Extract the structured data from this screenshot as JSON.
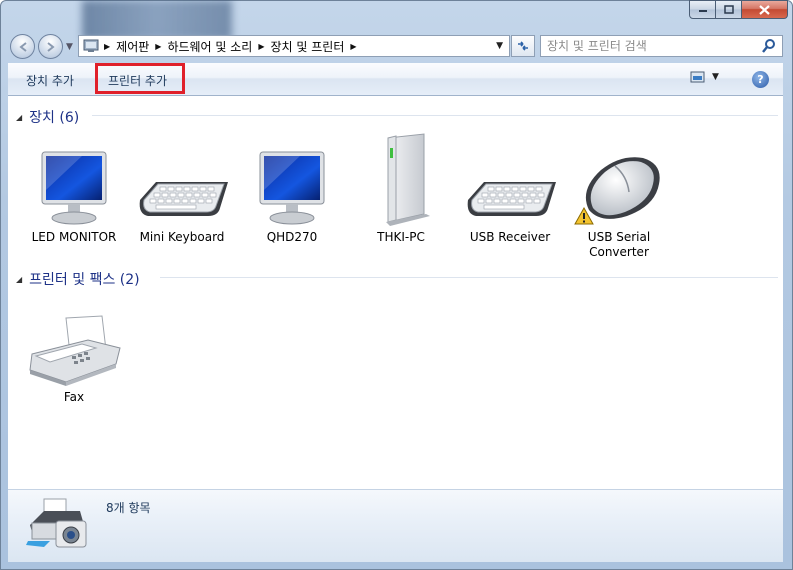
{
  "window": {
    "controls": {
      "minimize_icon": "minimize-icon",
      "maximize_icon": "maximize-icon",
      "close_icon": "close-icon"
    }
  },
  "address_bar": {
    "breadcrumbs": [
      "제어판",
      "하드웨어 및 소리",
      "장치 및 프린터"
    ]
  },
  "search": {
    "placeholder": "장치 및 프린터 검색"
  },
  "toolbar": {
    "add_device_label": "장치 추가",
    "add_printer_label": "프린터 추가",
    "highlight_color": "#e0202a"
  },
  "groups": {
    "devices": {
      "title": "장치 (6)",
      "items": [
        {
          "name": "LED MONITOR",
          "icon": "monitor-icon"
        },
        {
          "name": "Mini Keyboard",
          "icon": "keyboard-icon"
        },
        {
          "name": "QHD270",
          "icon": "monitor-icon"
        },
        {
          "name": "THKI-PC",
          "icon": "computer-tower-icon"
        },
        {
          "name": "USB Receiver",
          "icon": "keyboard-icon"
        },
        {
          "name": "USB Serial Converter",
          "icon": "mouse-warning-icon"
        }
      ]
    },
    "printers": {
      "title": "프린터 및 팩스 (2)",
      "items": [
        {
          "name": "Fax",
          "icon": "fax-icon"
        }
      ]
    }
  },
  "details": {
    "count_text": "8개 항목",
    "icon": "printer-camera-icon"
  }
}
